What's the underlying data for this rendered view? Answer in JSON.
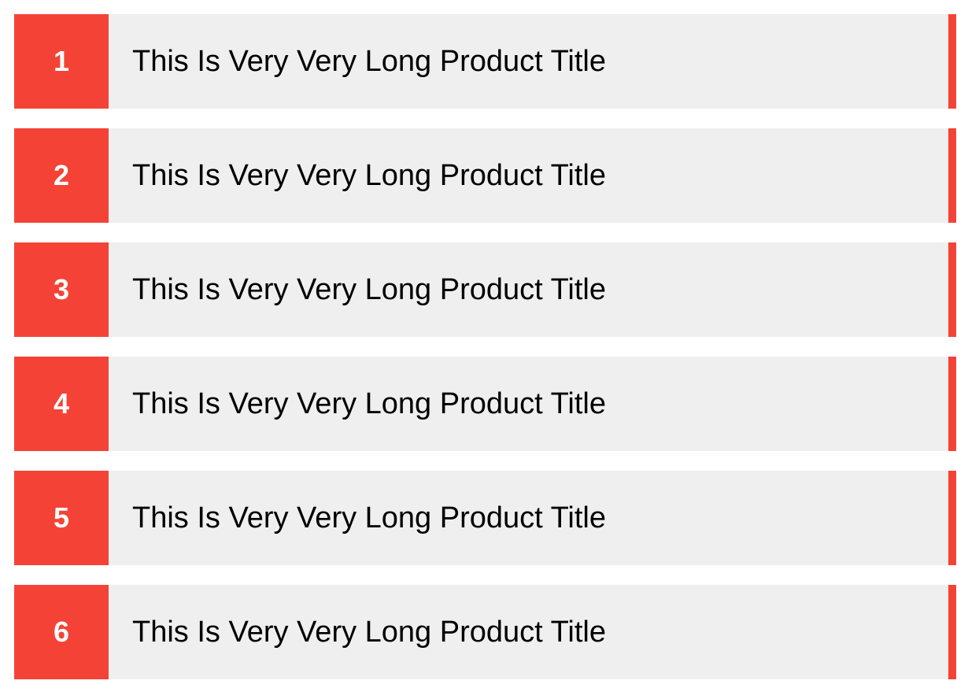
{
  "colors": {
    "accent": "#f44336",
    "row_background": "#efefef",
    "page_background": "#ffffff",
    "number_text": "#ffffff",
    "title_text": "#000000"
  },
  "items": [
    {
      "number": "1",
      "title": "This Is Very Very Long Product Title"
    },
    {
      "number": "2",
      "title": "This Is Very Very Long Product Title"
    },
    {
      "number": "3",
      "title": "This Is Very Very Long Product Title"
    },
    {
      "number": "4",
      "title": "This Is Very Very Long Product Title"
    },
    {
      "number": "5",
      "title": "This Is Very Very Long Product Title"
    },
    {
      "number": "6",
      "title": "This Is Very Very Long Product Title"
    }
  ]
}
